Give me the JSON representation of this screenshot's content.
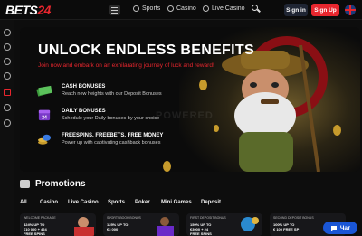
{
  "header": {
    "logo_prefix": "BETS",
    "logo_number": "24",
    "nav": [
      "Sports",
      "Casino",
      "Live Casino"
    ],
    "signin_label": "Sign in",
    "signup_label": "Sign Up",
    "accent": "#e8262e"
  },
  "hero": {
    "title": "UNLOCK ENDLESS BENEFITS",
    "subtitle": "Join now and embark on an exhilarating journey of luck and reward!",
    "features": [
      {
        "title": "CASH BONUSES",
        "desc": "Reach new heights with our Deposit Bonuses",
        "icon": "cash-icon"
      },
      {
        "title": "DAILY BONUSES",
        "desc": "Schedule your Daily bonuses by your choice",
        "icon": "calendar-icon"
      },
      {
        "title": "FREESPINS, FREEBETS, FREE MONEY",
        "desc": "Power up with captivating cashback bonuses",
        "icon": "coins-icon"
      }
    ],
    "watermark": "POWERED"
  },
  "promotions": {
    "title": "Promotions",
    "tabs": [
      "All",
      "Casino",
      "Live Casino",
      "Sports",
      "Poker",
      "Mini Games",
      "Deposit"
    ],
    "cards": [
      {
        "label": "WELCOME PACKAGE",
        "text": "424% UP TO\n€10 000 + 424\nFREE SPINS"
      },
      {
        "label": "SPORTSBOOK BONUS",
        "text": "125% UP TO\n€3 000"
      },
      {
        "label": "FIRST DEPOSIT BONUS",
        "text": "150% UP TO\n€3000 + 24\nFREE SPINS"
      },
      {
        "label": "SECOND DEPOSIT BONUS",
        "text": "100% UP TO\n€ 100 FREE SP"
      }
    ]
  },
  "chat": {
    "label": "Чат"
  }
}
